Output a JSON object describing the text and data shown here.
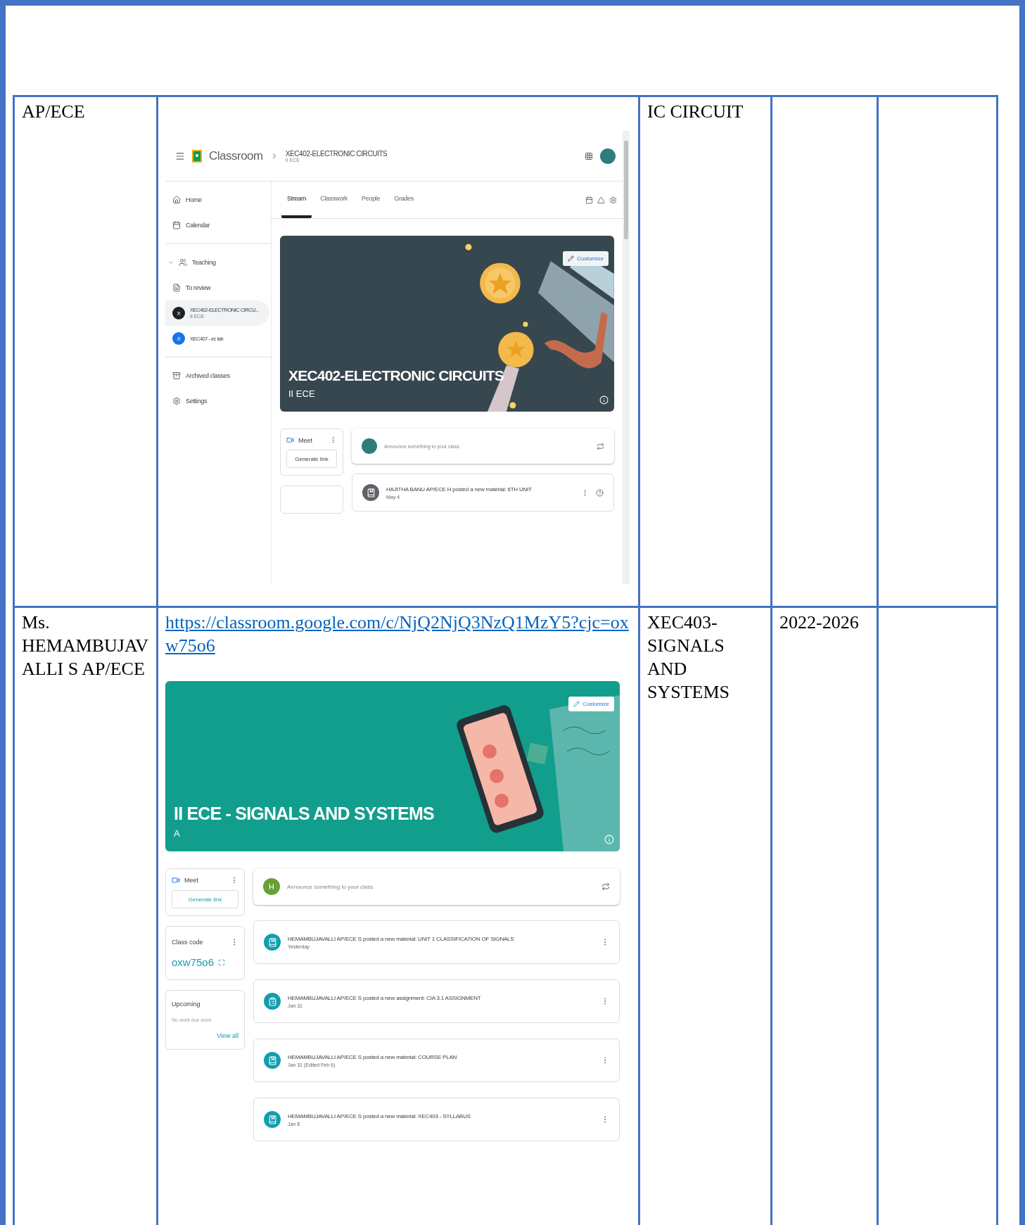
{
  "table": {
    "rows": [
      {
        "column_1": "AP/ECE",
        "column_3": "IC CIRCUIT",
        "column_2": {
          "kind": "app_window",
          "header": {
            "app_name": "Classroom",
            "class_title": "XEC402-ELECTRONIC CIRCUITS",
            "class_section": "II ECE"
          },
          "sidebar": {
            "items": [
              {
                "label": "Home",
                "kind": "home"
              },
              {
                "label": "Calendar",
                "kind": "calendar"
              }
            ],
            "teaching": {
              "label": "Teaching",
              "expanded": true,
              "items": [
                {
                  "label": "To review",
                  "kind": "review"
                }
              ],
              "classes": [
                {
                  "initial": "X",
                  "name": "XEC402-ELECTRONIC CIRCU...",
                  "section": "II ECE",
                  "selected": true,
                  "color": "#202124"
                },
                {
                  "initial": "X",
                  "name": "XEC407 - ec lab",
                  "selected": false,
                  "color": "#1a73e8"
                }
              ]
            },
            "bottom_items": [
              {
                "label": "Archived classes",
                "kind": "archive"
              },
              {
                "label": "Settings",
                "kind": "settings"
              }
            ]
          },
          "tabs": [
            {
              "label": "Stream",
              "selected": true
            },
            {
              "label": "Classwork",
              "selected": false
            },
            {
              "label": "People",
              "selected": false
            },
            {
              "label": "Grades",
              "selected": false
            }
          ],
          "banner": {
            "title": "XEC402-ELECTRONIC CIRCUITS",
            "section": "II ECE",
            "customize": "Customize"
          },
          "meet": {
            "label": "Meet",
            "button": "Generate link"
          },
          "announce": {
            "placeholder": "Announce something to your class"
          },
          "posts": [
            {
              "kind": "material",
              "text": "HAJITHA BANU AP/ECE H posted a new material: 6TH UNIT",
              "date": "May 4"
            }
          ]
        }
      },
      {
        "column_1": "Ms. HEMAMBUJAVALLI S AP/ECE",
        "column_3": "XEC403- SIGNALS AND SYSTEMS",
        "column_4": "2022-2026",
        "column_2": {
          "kind": "stream_view",
          "link": "https://classroom.google.com/c/NjQ2NjQ3NzQ1MzY5?cjc=oxw75o6",
          "banner": {
            "title": "II ECE - SIGNALS AND SYSTEMS",
            "section": "A",
            "customize": "Customize"
          },
          "meet": {
            "label": "Meet",
            "button": "Generate link"
          },
          "class_code": {
            "label": "Class code",
            "code": "oxw75o6"
          },
          "upcoming": {
            "label": "Upcoming",
            "empty": "No work due soon",
            "link": "View all"
          },
          "announce": {
            "avatar": "H",
            "placeholder": "Announce something to your class"
          },
          "posts": [
            {
              "kind": "material",
              "text": "HEMAMBUJAVALLI AP/ECE S posted a new material: UNIT 1 CLASSIFICATION OF SIGNALS",
              "date": "Yesterday"
            },
            {
              "kind": "assignment",
              "text": "HEMAMBUJAVALLI AP/ECE S posted a new assignment: CIA 3.1 ASSIGNMENT",
              "date": "Jan 31"
            },
            {
              "kind": "material",
              "text": "HEMAMBUJAVALLI AP/ECE S posted a new material: COURSE PLAN",
              "date": "Jan 31 (Edited Feb 6)"
            },
            {
              "kind": "material",
              "text": "HEMAMBUJAVALLI AP/ECE S posted a new material: XEC403 - SYLLABUS",
              "date": "Jan 8"
            }
          ]
        }
      }
    ]
  }
}
